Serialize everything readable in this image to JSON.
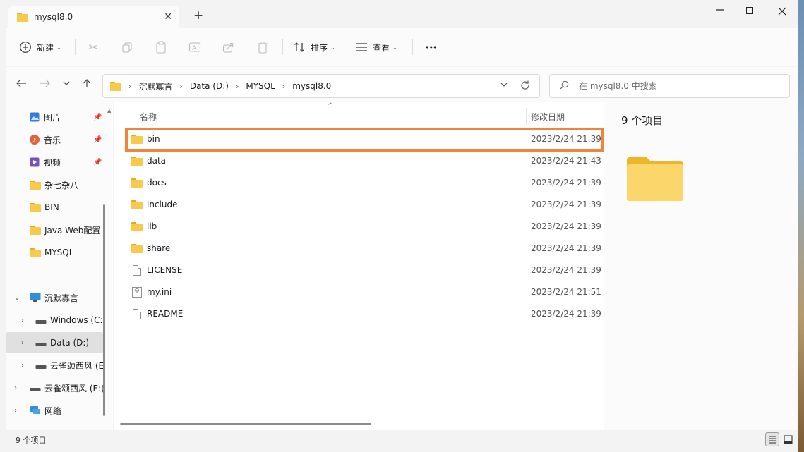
{
  "window": {
    "tab_title": "mysql8.0",
    "close_glyph": "✕",
    "new_tab_glyph": "+"
  },
  "toolbar": {
    "new_label": "新建",
    "sort_label": "排序",
    "view_label": "查看",
    "more_glyph": "•••"
  },
  "address": {
    "breadcrumbs": [
      "沉默寡言",
      "Data (D:)",
      "MYSQL",
      "mysql8.0"
    ]
  },
  "search": {
    "placeholder": "在 mysql8.0 中搜索"
  },
  "sidebar": {
    "items": [
      {
        "label": "图片",
        "icon": "picture-icon",
        "pinned": true
      },
      {
        "label": "音乐",
        "icon": "music-icon",
        "pinned": true
      },
      {
        "label": "视频",
        "icon": "video-icon",
        "pinned": true
      },
      {
        "label": "杂七杂八",
        "icon": "folder-icon",
        "pinned": false
      },
      {
        "label": "BIN",
        "icon": "folder-icon",
        "pinned": false
      },
      {
        "label": "Java Web配置",
        "icon": "folder-icon",
        "pinned": false
      },
      {
        "label": "MYSQL",
        "icon": "folder-icon",
        "pinned": false
      }
    ],
    "tree": [
      {
        "label": "沉默寡言",
        "icon": "computer-icon",
        "expanded": true
      },
      {
        "label": "Windows (C:)",
        "icon": "drive-icon"
      },
      {
        "label": "Data (D:)",
        "icon": "drive-icon",
        "selected": true
      },
      {
        "label": "云雀颂西风 (E",
        "icon": "drive-icon"
      },
      {
        "label": "云雀颂西风 (E:)",
        "icon": "drive-icon"
      },
      {
        "label": "网络",
        "icon": "network-icon"
      }
    ]
  },
  "filelist": {
    "col_name": "名称",
    "col_date": "修改日期",
    "rows": [
      {
        "name": "bin",
        "date": "2023/2/24 21:39",
        "type": "folder"
      },
      {
        "name": "data",
        "date": "2023/2/24 21:43",
        "type": "folder"
      },
      {
        "name": "docs",
        "date": "2023/2/24 21:39",
        "type": "folder"
      },
      {
        "name": "include",
        "date": "2023/2/24 21:39",
        "type": "folder"
      },
      {
        "name": "lib",
        "date": "2023/2/24 21:39",
        "type": "folder"
      },
      {
        "name": "share",
        "date": "2023/2/24 21:39",
        "type": "folder"
      },
      {
        "name": "LICENSE",
        "date": "2023/2/24 21:39",
        "type": "file"
      },
      {
        "name": "my.ini",
        "date": "2023/2/24 21:51",
        "type": "ini"
      },
      {
        "name": "README",
        "date": "2023/2/24 21:39",
        "type": "file"
      }
    ]
  },
  "preview": {
    "count": "9 个项目"
  },
  "status": {
    "count": "9 个项目"
  },
  "colors": {
    "highlight": "#f0843a",
    "folder": "#f7c94c"
  }
}
